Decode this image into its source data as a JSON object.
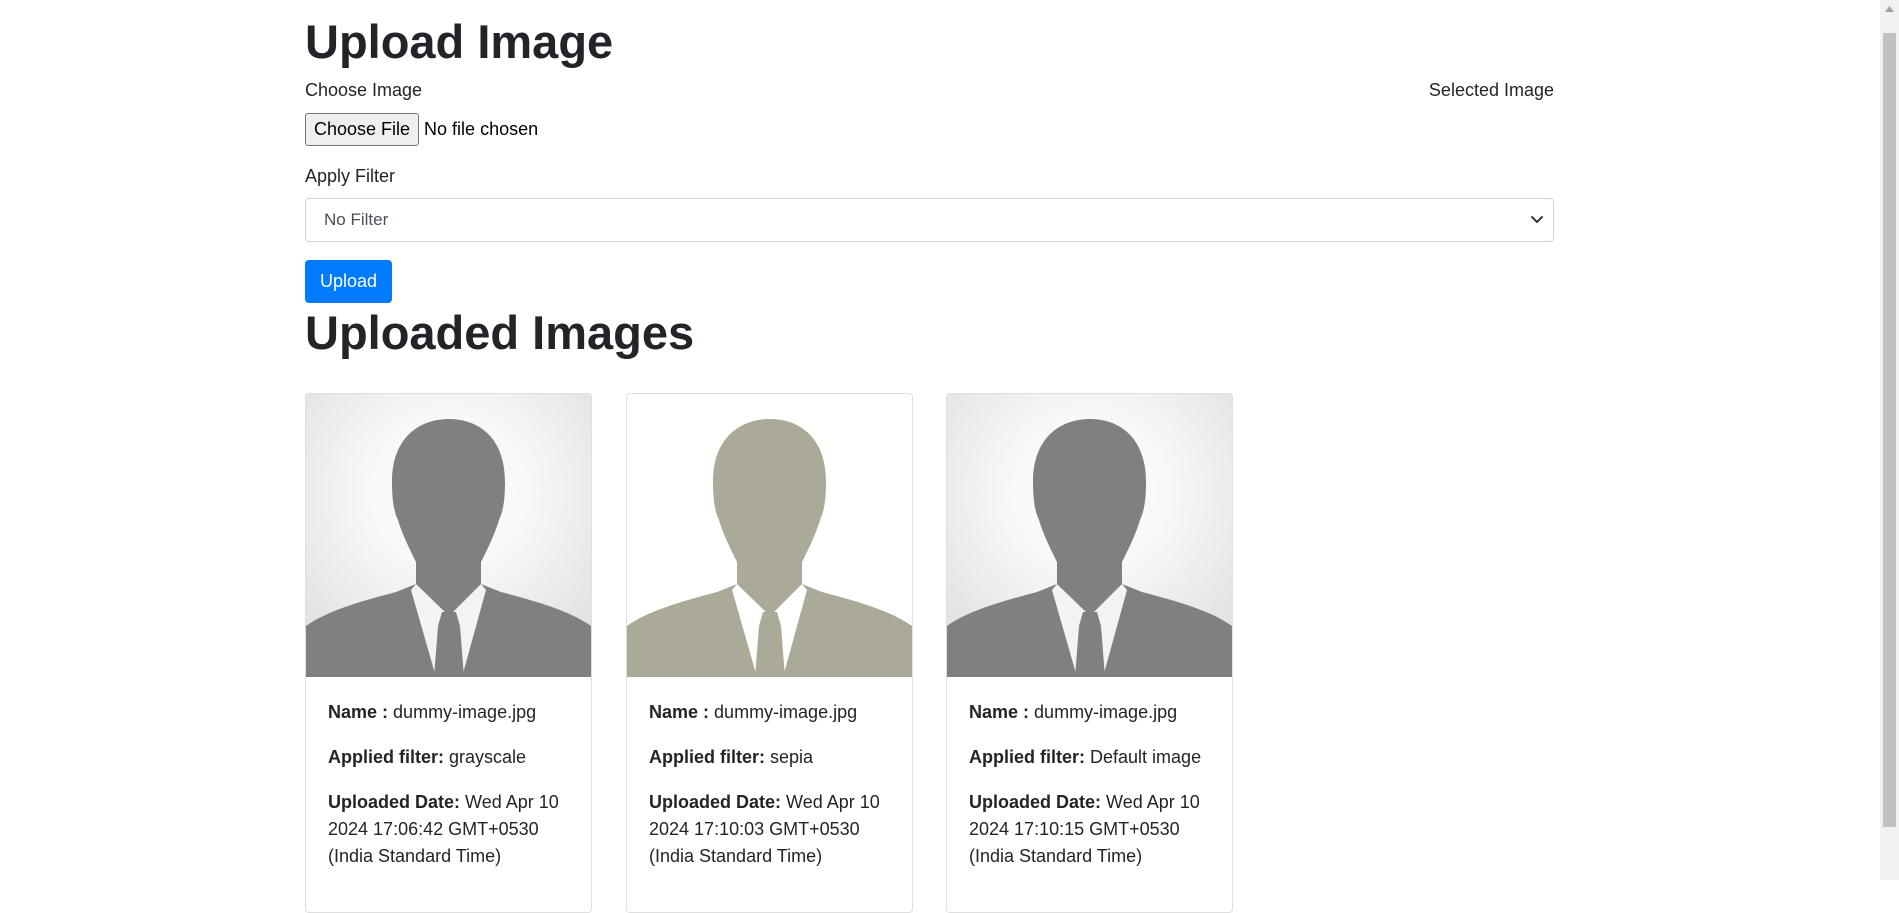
{
  "upload": {
    "title": "Upload Image",
    "choose_label": "Choose Image",
    "selected_label": "Selected Image",
    "file_button": "Choose File",
    "file_status": "No file chosen",
    "filter_label": "Apply Filter",
    "filter_selected": "No Filter",
    "upload_button": "Upload"
  },
  "gallery": {
    "title": "Uploaded Images",
    "name_label": "Name :",
    "filter_label": "Applied filter:",
    "date_label": "Uploaded Date:",
    "cards": [
      {
        "name": "dummy-image.jpg",
        "filter": "grayscale",
        "date": "Wed Apr 10 2024 17:06:42 GMT+0530 (India Standard Time)"
      },
      {
        "name": "dummy-image.jpg",
        "filter": "sepia",
        "date": "Wed Apr 10 2024 17:10:03 GMT+0530 (India Standard Time)"
      },
      {
        "name": "dummy-image.jpg",
        "filter": "Default image",
        "date": "Wed Apr 10 2024 17:10:15 GMT+0530 (India Standard Time)"
      }
    ]
  },
  "colors": {
    "primary": "#007bff",
    "silhouette_gray": "#808080",
    "silhouette_sepia": "#aba997"
  },
  "icons": [
    "chevron-down-icon",
    "person-silhouette-icon",
    "scroll-up-arrow-icon"
  ]
}
